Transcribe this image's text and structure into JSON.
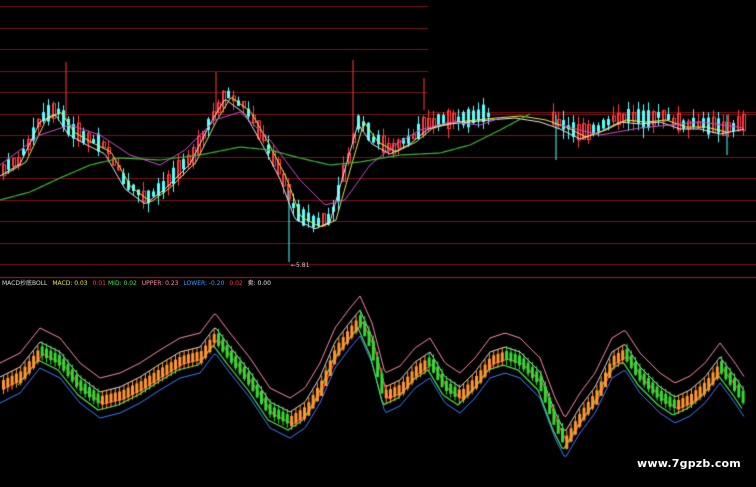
{
  "colors": {
    "background": "#000000",
    "gridline": "#7a1414",
    "divider": "#b41e1e",
    "up_candle": "#ff3c3c",
    "down_candle": "#54ffff",
    "ma_white": "#e6e6e6",
    "ma_yellow": "#e6e650",
    "ma_magenta": "#c850c8",
    "ma_green": "#3cb43c",
    "mid_line": "#4ce64c",
    "upper_line": "#ff3c3c",
    "lower_line": "#3c7cff",
    "osc_white": "#dcdcdc",
    "osc_pink": "#ff8caa",
    "bar_orange": "#ff9632",
    "bar_green": "#32dc32"
  },
  "indicator_legend": {
    "name": "MACD抄底BOLL",
    "macd_label": "MACD: 0.03",
    "macd_second": "0.01",
    "mid_label": "MID: 0.02",
    "upper_label": "UPPER: 0.23",
    "lower_label": "LOWER: -0.20",
    "extra_value": "0.02",
    "sell_label": "卖: 0.00"
  },
  "price_low_label": "←5.81",
  "watermark": "www.7gpzb.com"
}
